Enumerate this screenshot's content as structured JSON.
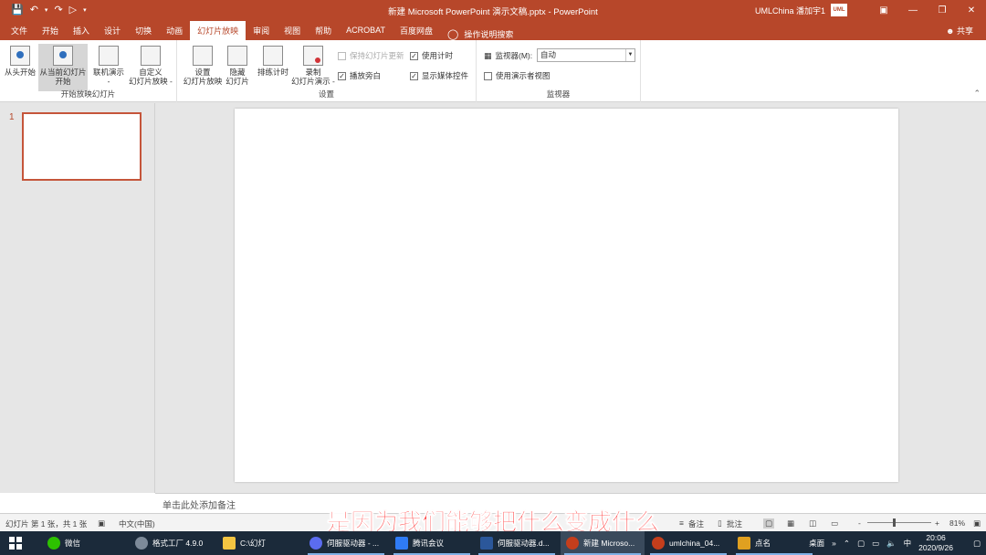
{
  "window": {
    "title": "新建 Microsoft PowerPoint 演示文稿.pptx  -  PowerPoint",
    "user": "UMLChina 潘加宇1",
    "avatar": "UML"
  },
  "qat": {
    "save_icon": "save-icon",
    "undo_icon": "undo-icon",
    "redo_icon": "redo-icon",
    "present_icon": "present-icon"
  },
  "tabs": [
    "文件",
    "开始",
    "插入",
    "设计",
    "切换",
    "动画",
    "幻灯片放映",
    "审阅",
    "视图",
    "帮助",
    "ACROBAT",
    "百度网盘"
  ],
  "active_tab": "幻灯片放映",
  "tell_me": "操作说明搜索",
  "share": "共享",
  "ribbon": {
    "start_group": {
      "label": "开始放映幻灯片",
      "from_beginning": "从头开始",
      "from_current_1": "从当前幻灯片",
      "from_current_2": "开始",
      "online_1": "联机演示",
      "online_2": "-",
      "custom_1": "自定义",
      "custom_2": "幻灯片放映 -"
    },
    "setup_group": {
      "label": "设置",
      "setup_1": "设置",
      "setup_2": "幻灯片放映",
      "hide_1": "隐藏",
      "hide_2": "幻灯片",
      "rehearse": "排练计时",
      "record_1": "录制",
      "record_2": "幻灯片演示 -",
      "keep_updated": "保持幻灯片更新",
      "play_narrations": "播放旁白",
      "use_timings": "使用计时",
      "show_media": "显示媒体控件"
    },
    "monitor_group": {
      "label": "监视器",
      "monitor_label": "监视器(M):",
      "monitor_value": "自动",
      "presenter_view": "使用演示者视图"
    }
  },
  "thumbnail": {
    "number": "1"
  },
  "notes_placeholder": "单击此处添加备注",
  "status": {
    "slide_info": "幻灯片 第 1 张，共 1 张",
    "language": "中文(中国)",
    "notes": "备注",
    "comments": "批注",
    "zoom": "81%",
    "minus": "-",
    "plus": "+"
  },
  "subtitle": "是因为我们能够把什么变成什么",
  "taskbar": {
    "items": [
      {
        "label": "微信",
        "color": "#2dc100"
      },
      {
        "label": "格式工厂 4.9.0",
        "color": "#7d8a99"
      },
      {
        "label": "C:\\幻灯",
        "color": "#f4c542"
      },
      {
        "label": "伺服驱动器 - ...",
        "color": "#5b6cf0"
      },
      {
        "label": "腾讯会议",
        "color": "#2f7bf5"
      },
      {
        "label": "伺服驱动器.d...",
        "color": "#2b579a"
      },
      {
        "label": "新建 Microso...",
        "color": "#c43e1c"
      },
      {
        "label": "umlchina_04...",
        "color": "#c43e1c"
      },
      {
        "label": "点名",
        "color": "#e0a020"
      }
    ],
    "desktop": "桌面",
    "overflow": "»",
    "ime": "中",
    "time": "20:06",
    "date": "2020/9/26"
  }
}
